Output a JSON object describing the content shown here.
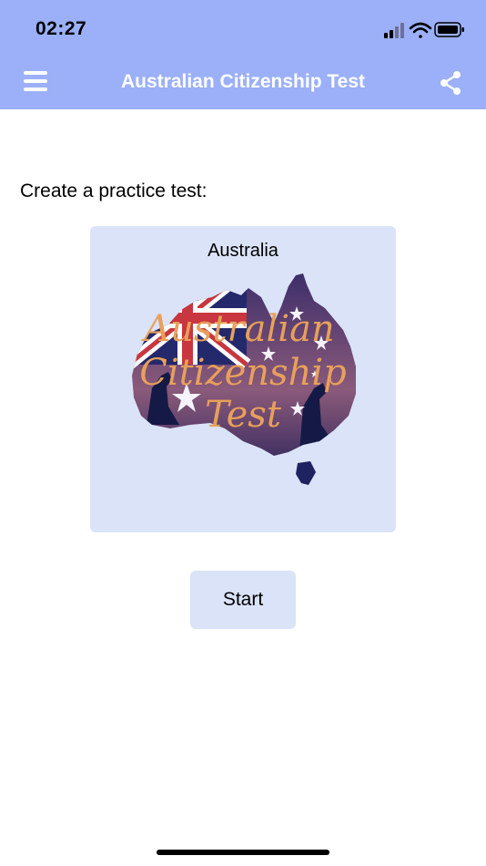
{
  "status_bar": {
    "time": "02:27",
    "icons": [
      "cellular-signal-icon",
      "wifi-icon",
      "battery-icon"
    ]
  },
  "header": {
    "title": "Australian Citizenship Test",
    "menu_icon": "hamburger-menu-icon",
    "share_icon": "share-icon",
    "background_color": "#9bb0f8"
  },
  "main": {
    "prompt": "Create a practice test:",
    "card": {
      "title": "Australia",
      "logo_text": [
        "Australian",
        "Citizenship",
        "Test"
      ],
      "background_color": "#dbe3f8"
    },
    "start_button": {
      "label": "Start"
    }
  }
}
